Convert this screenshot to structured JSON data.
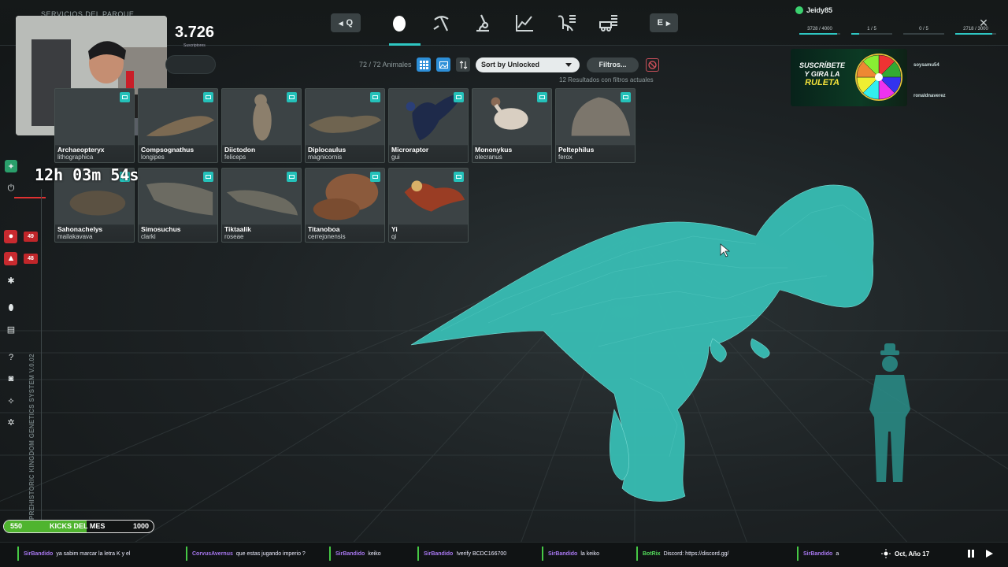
{
  "top_bar": {
    "park_services": "SERVICIOS DEL PARQUE",
    "nav_prev": "Q",
    "nav_next": "E",
    "tabs": [
      "genome-tab",
      "excavation-tab",
      "lab-tab",
      "stats-tab",
      "species-tab",
      "vehicle-tab"
    ]
  },
  "stream": {
    "subscribers": "3.726",
    "subscribers_label": "Suscriptores",
    "timer": "12h 03m 54s",
    "kicks_left": "550",
    "kicks_label": "KICKS DEL MES",
    "kicks_goal": "1000",
    "kicks_progress": 0.55
  },
  "user": {
    "name": "Jeidy85",
    "resources": [
      {
        "value": "3728 / 4000",
        "fill": 0.93
      },
      {
        "value": "1 / 5",
        "fill": 0.2
      },
      {
        "value": "0 / 5",
        "fill": 0.0
      },
      {
        "value": "2718 / 3000",
        "fill": 0.9
      }
    ]
  },
  "toolbar": {
    "animal_count": "72 / 72",
    "animal_label": "Animales",
    "sort_label": "Sort by Unlocked",
    "filters_label": "Filtros...",
    "result_count": "12",
    "result_label": "Resultados con filtros actuales"
  },
  "animals": [
    {
      "name": "Archaeopteryx",
      "species": "lithographica",
      "color": "#6b5a45"
    },
    {
      "name": "Compsognathus",
      "species": "longipes",
      "color": "#7c6a52"
    },
    {
      "name": "Diictodon",
      "species": "feliceps",
      "color": "#8c7f6c"
    },
    {
      "name": "Diplocaulus",
      "species": "magnicornis",
      "color": "#6f6450"
    },
    {
      "name": "Microraptor",
      "species": "gui",
      "color": "#1e2a4a"
    },
    {
      "name": "Mononykus",
      "species": "olecranus",
      "color": "#8a6a55"
    },
    {
      "name": "Peltephilus",
      "species": "ferox",
      "color": "#7c766c"
    },
    {
      "name": "Sahonachelys",
      "species": "mailakavava",
      "color": "#5b5142"
    },
    {
      "name": "Simosuchus",
      "species": "clarki",
      "color": "#6c6b62"
    },
    {
      "name": "Tiktaalik",
      "species": "roseae",
      "color": "#6b6a60"
    },
    {
      "name": "Titanoboa",
      "species": "cerrejonensis",
      "color": "#8b5a3c"
    },
    {
      "name": "Yi",
      "species": "qi",
      "color": "#7a3a22"
    }
  ],
  "sidebar": {
    "badge_1": "49",
    "badge_2": "48",
    "system_text": "PREHISTORIC KINGDOM GENETICS SYSTEM V.0.02"
  },
  "promo": {
    "line1": "SUSCRÍBETE",
    "line2": "Y GIRA LA",
    "line3": "RULETA",
    "viewers": [
      "soysamu54",
      "ronaldnaverez"
    ]
  },
  "chat": [
    {
      "user": "SirBandido",
      "text": "ya sabim marcar la letra K y el"
    },
    {
      "user": "CorvusAvernus",
      "text": "que estas jugando imperio ?"
    },
    {
      "user": "SirBandido",
      "text": "keiko"
    },
    {
      "user": "SirBandido",
      "text": "!verify BCDC166700"
    },
    {
      "user": "SirBandido",
      "text": "la keiko"
    },
    {
      "user": "BotRix",
      "text": "Discord: https://discord.gg/"
    },
    {
      "user": "SirBandido",
      "text": "a"
    }
  ],
  "time": {
    "date": "Oct, Año 17"
  },
  "colors": {
    "accent": "#2ec7c3",
    "hologram": "#3fbfb6",
    "alert": "#c0262a"
  }
}
